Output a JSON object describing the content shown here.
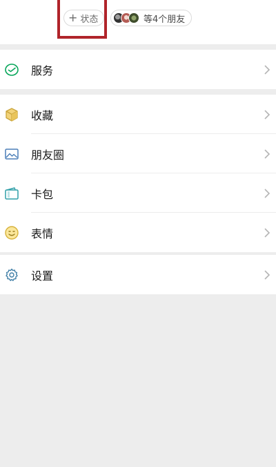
{
  "header": {
    "status_button": {
      "plus": "+",
      "label": "状态"
    },
    "friends_button": {
      "label": "等4个朋友"
    }
  },
  "menu": {
    "services": {
      "label": "服务",
      "icon": "service-icon"
    },
    "favorites": {
      "label": "收藏",
      "icon": "cube-icon"
    },
    "moments": {
      "label": "朋友圈",
      "icon": "image-icon"
    },
    "cards": {
      "label": "卡包",
      "icon": "wallet-icon"
    },
    "stickers": {
      "label": "表情",
      "icon": "smiley-icon"
    },
    "settings": {
      "label": "设置",
      "icon": "gear-icon"
    }
  },
  "colors": {
    "accent_green": "#07c160",
    "highlight_red": "#b0242a",
    "background": "#ededed"
  }
}
